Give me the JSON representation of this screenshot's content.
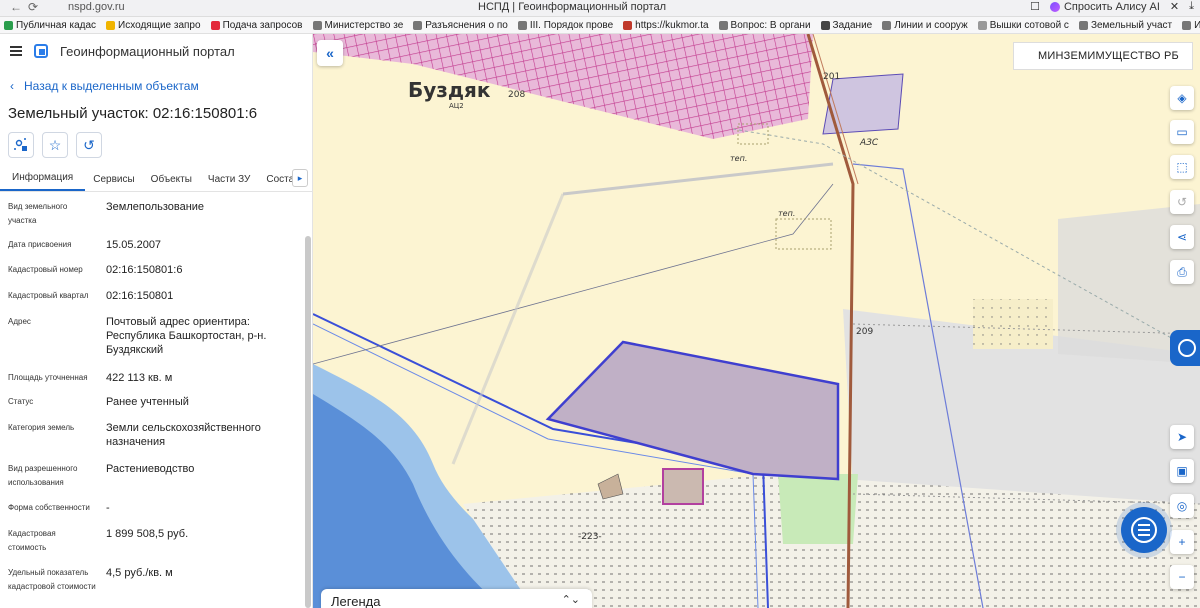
{
  "browser": {
    "url": "nspd.gov.ru",
    "tab_title": "НСПД | Геоинформационный портал",
    "alisa": "Спросить Алису AI"
  },
  "bookmarks": [
    {
      "label": "Публичная кадас",
      "color": "#2a9d4c"
    },
    {
      "label": "Исходящие запро",
      "color": "#f0b400"
    },
    {
      "label": "Подача запросов",
      "color": "#e3283a"
    },
    {
      "label": "Министерство зе",
      "color": "#777777"
    },
    {
      "label": "Разъяснения о по",
      "color": "#777777"
    },
    {
      "label": "III. Порядок прове",
      "color": "#777777"
    },
    {
      "label": "https://kukmor.ta",
      "color": "#c0392b"
    },
    {
      "label": "Вопрос: В органи",
      "color": "#777777"
    },
    {
      "label": "Задание",
      "color": "#444444"
    },
    {
      "label": "Линии и сооруж",
      "color": "#777777"
    },
    {
      "label": "Вышки сотовой с",
      "color": "#999999"
    },
    {
      "label": "Земельный участ",
      "color": "#777777"
    },
    {
      "label": "Извещение №3 о",
      "color": "#777777"
    },
    {
      "label": "https://www",
      "color": "#777777"
    }
  ],
  "header": {
    "title": "Геоинформационный портал"
  },
  "panel": {
    "back_label": "Назад к выделенным объектам",
    "title": "Земельный участок: 02:16:150801:6",
    "tabs": [
      "Информация",
      "Сервисы",
      "Объекты",
      "Части ЗУ",
      "Состав"
    ],
    "properties": [
      {
        "label": "Вид земельного участка",
        "value": "Землепользование"
      },
      {
        "label": "Дата присвоения",
        "value": "15.05.2007"
      },
      {
        "label": "Кадастровый номер",
        "value": "02:16:150801:6"
      },
      {
        "label": "Кадастровый квартал",
        "value": "02:16:150801"
      },
      {
        "label": "Адрес",
        "value": "Почтовый адрес ориентира: Республика Башкортостан, р-н. Буздякский"
      },
      {
        "label": "Площадь уточненная",
        "value": "422 113 кв. м"
      },
      {
        "label": "Статус",
        "value": "Ранее учтенный"
      },
      {
        "label": "Категория земель",
        "value": "Земли сельскохозяйственного назначения"
      },
      {
        "label": "Вид разрешенного использования",
        "value": "Растениеводство"
      },
      {
        "label": "Форма собственности",
        "value": "-"
      },
      {
        "label": "Кадастровая стоимость",
        "value": "1 899 508,5 руб."
      },
      {
        "label": "Удельный показатель кадастровой стоимости",
        "value": "4,5 руб./кв. м"
      }
    ]
  },
  "map": {
    "org": "МИНЗЕМИМУЩЕСТВО РБ",
    "town": "Буздяк",
    "town_code": "АЦ2",
    "labels": [
      "208",
      "201",
      "АЗС",
      "теп.",
      "теп.",
      "209",
      "-223-"
    ],
    "legend": "Легенда"
  }
}
